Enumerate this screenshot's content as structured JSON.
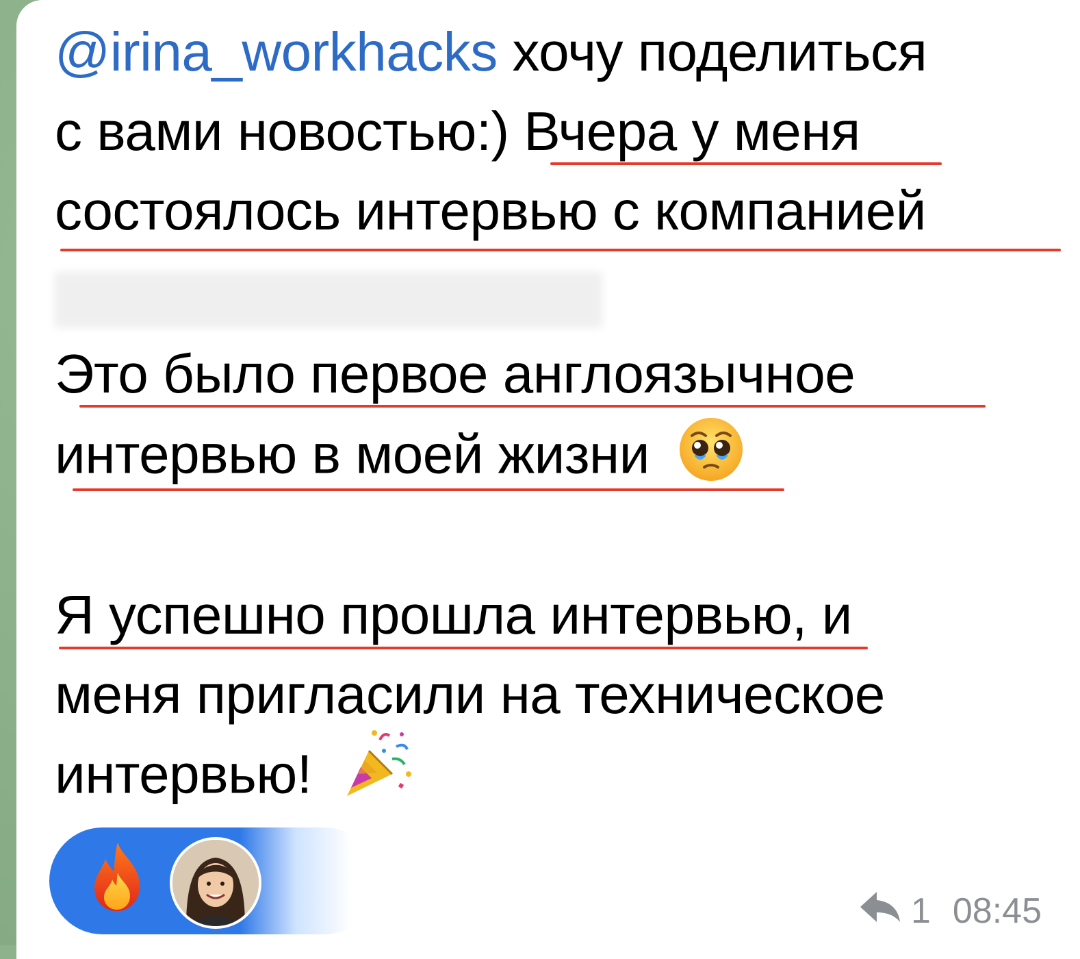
{
  "message": {
    "mention": "@irina_workhacks",
    "lines": [
      " хочу поделиться",
      "с вами новостью:) Вчера у меня",
      "состоялось интервью с компанией",
      "Это было первое англоязычное",
      "интервью в моей жизни",
      "Я успешно прошла интервью, и",
      "меня пригласили на техническое",
      "интервью!"
    ]
  },
  "emojis": {
    "teary_face": "pleading-face-with-tears-icon",
    "party_popper": "party-popper-icon",
    "reaction_fire": "fire-icon"
  },
  "reactions": {
    "emoji": "fire"
  },
  "meta": {
    "reply_count": "1",
    "time": "08:45"
  },
  "colors": {
    "background": "#8db28c",
    "mention": "#2d6bc5",
    "underline": "#e53a2b",
    "reaction_pill": "#2f78e8",
    "meta_text": "#8b8f93"
  }
}
